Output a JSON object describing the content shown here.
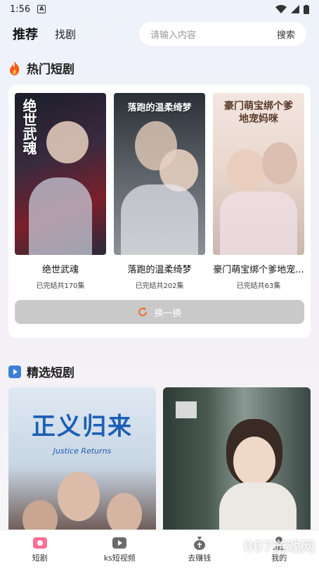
{
  "status_bar": {
    "time": "1:56",
    "notif_glyph": "A"
  },
  "header": {
    "tab_active": "推荐",
    "tab_other": "找剧",
    "search_placeholder": "请输入内容",
    "search_button": "搜索"
  },
  "hot": {
    "title": "热门短剧",
    "items": [
      {
        "name": "绝世武魂",
        "status": "已完结共170集",
        "poster_text": "绝世武魂"
      },
      {
        "name": "落跑的温柔绮梦",
        "status": "已完结共202集",
        "poster_text": "落跑的温柔绮梦"
      },
      {
        "name": "豪门萌宝绑个爹地宠...",
        "status": "已完结共63集",
        "poster_text": "豪门萌宝绑个爹地宠妈咪"
      }
    ],
    "swap_label": "换一换"
  },
  "featured": {
    "title": "精选短剧",
    "items": [
      {
        "poster_text": "正义归来",
        "poster_sub": "Justice Returns"
      },
      {
        "poster_text": ""
      }
    ]
  },
  "nav": {
    "items": [
      {
        "label": "短剧",
        "icon": "drama-icon"
      },
      {
        "label": "ks短视频",
        "icon": "video-play-icon"
      },
      {
        "label": "去赚钱",
        "icon": "money-bag-icon"
      },
      {
        "label": "我的",
        "icon": "profile-icon"
      }
    ]
  },
  "watermark": "007游戏网"
}
